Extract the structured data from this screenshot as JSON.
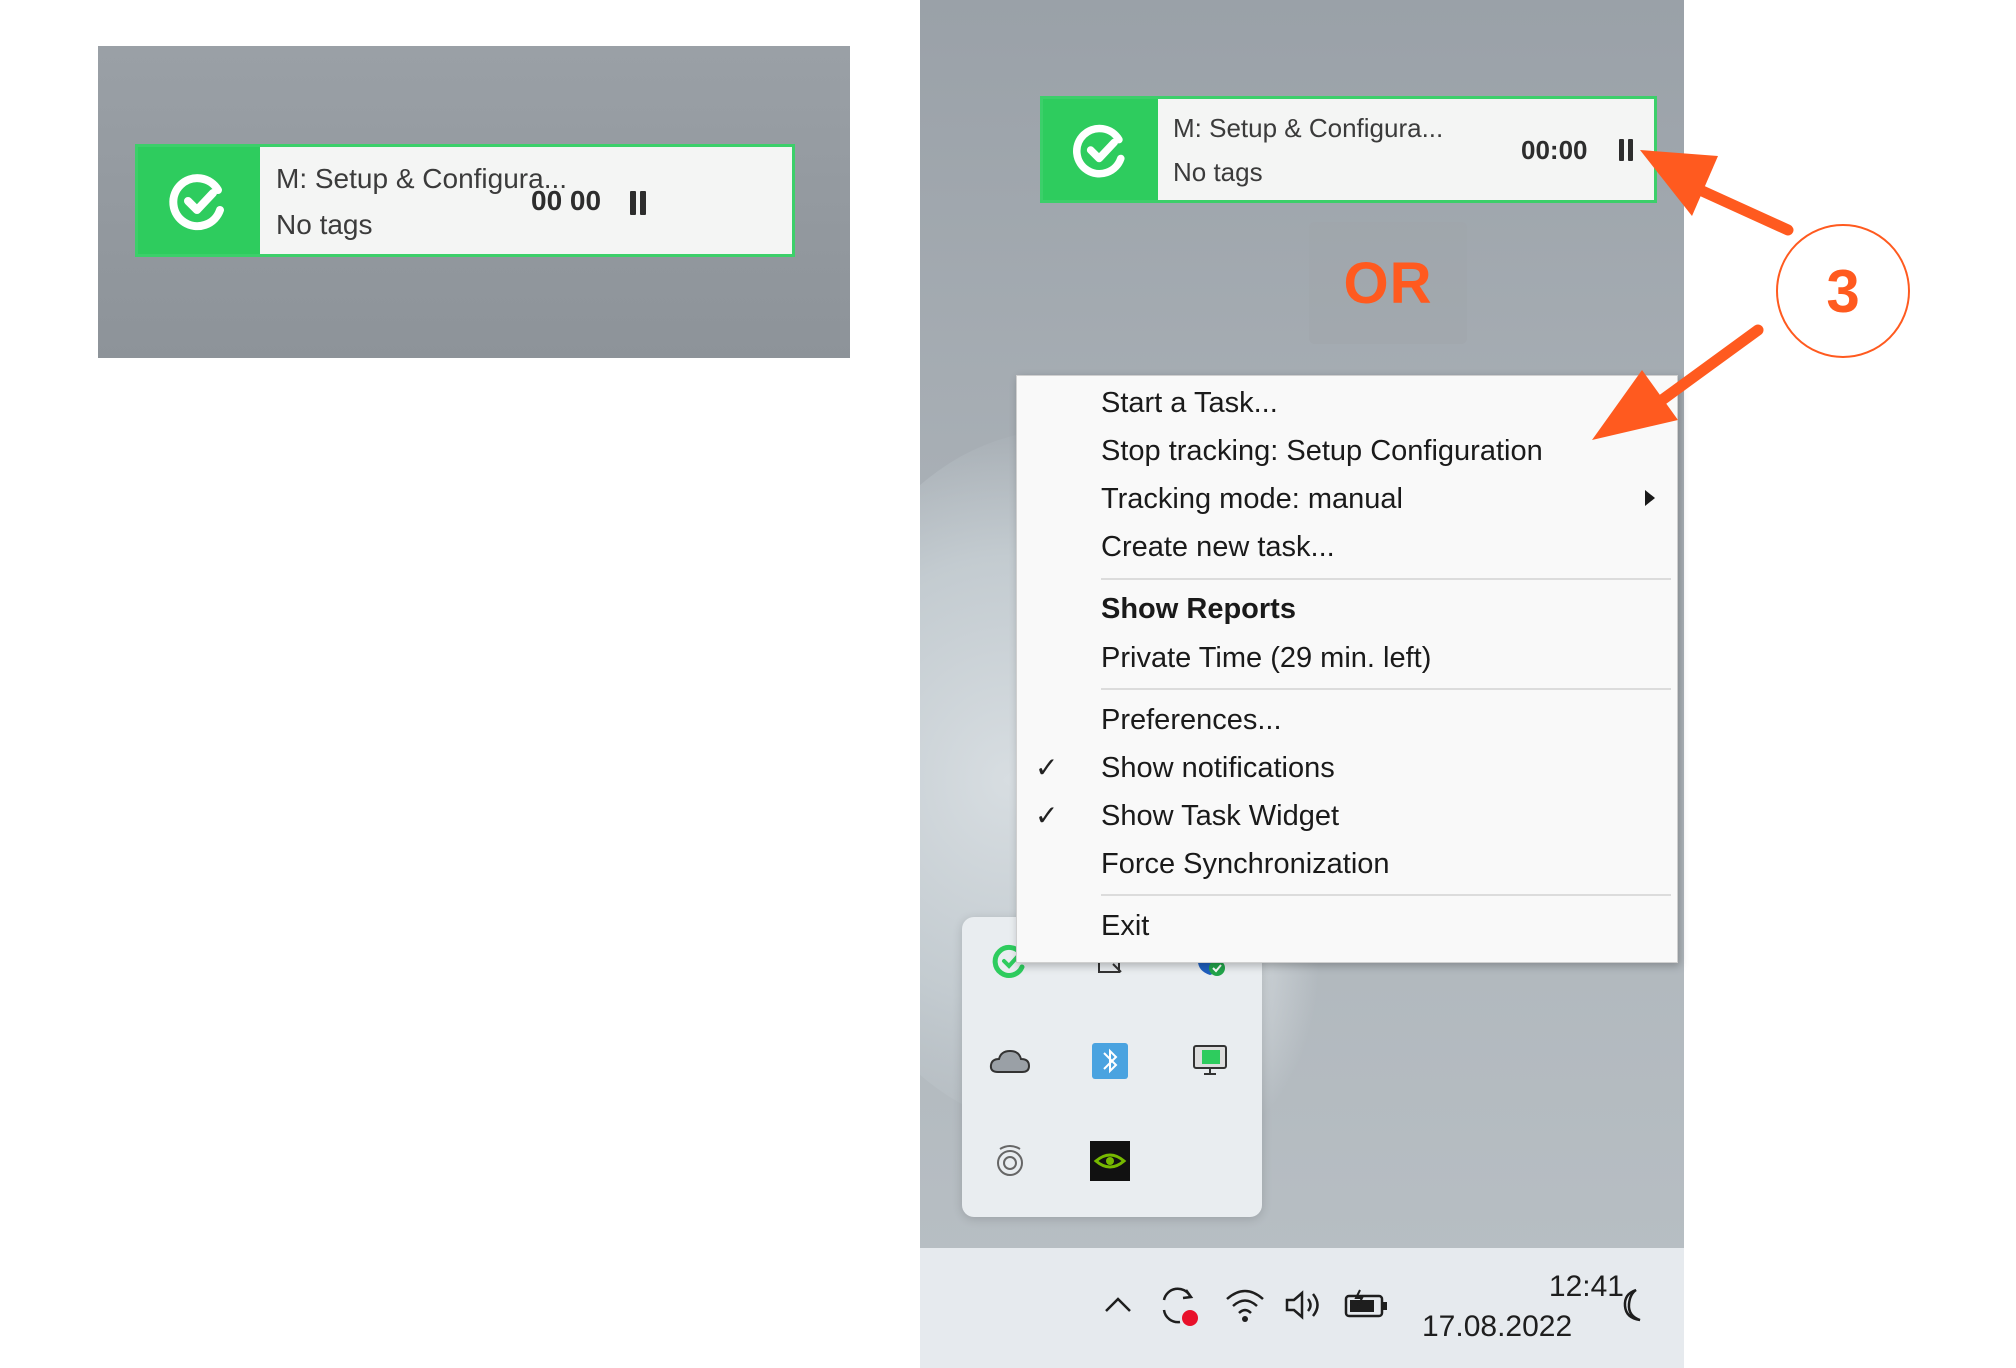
{
  "widget": {
    "title": "M: Setup & Configura...",
    "tags": "No tags",
    "timer_left": "00 00",
    "timer_right": "00:00"
  },
  "separator_text": "OR",
  "step_number": "3",
  "context_menu": {
    "items": [
      {
        "label": "Start a Task...",
        "checked": false,
        "bold": false
      },
      {
        "label": "Stop tracking: Setup  Configuration",
        "checked": false,
        "bold": false
      },
      {
        "label": "Tracking mode: manual",
        "checked": false,
        "bold": false,
        "submenu": true
      },
      {
        "label": "Create new task...",
        "checked": false,
        "bold": false
      },
      {
        "label": "Show Reports",
        "checked": false,
        "bold": true
      },
      {
        "label": "Private Time (29 min. left)",
        "checked": false,
        "bold": false
      },
      {
        "label": "Preferences...",
        "checked": false,
        "bold": false
      },
      {
        "label": "Show notifications",
        "checked": true,
        "bold": false
      },
      {
        "label": "Show Task Widget",
        "checked": true,
        "bold": false
      },
      {
        "label": "Force Synchronization",
        "checked": false,
        "bold": false
      },
      {
        "label": "Exit",
        "checked": false,
        "bold": false
      }
    ]
  },
  "tray": {
    "icons": [
      "timer-app-icon",
      "notes-icon",
      "security-shield-icon",
      "onedrive-cloud-icon",
      "bluetooth-tool-icon",
      "display-monitor-icon",
      "sound-control-icon",
      "nvidia-icon"
    ]
  },
  "taskbar": {
    "time": "12:41",
    "date": "17.08.2022",
    "icons": [
      "chevron-up-icon",
      "sync-icon",
      "wifi-icon",
      "volume-icon",
      "battery-icon",
      "moon-icon"
    ]
  },
  "colors": {
    "brand_green": "#2ecc5e",
    "accent_orange": "#ff5a1f"
  }
}
